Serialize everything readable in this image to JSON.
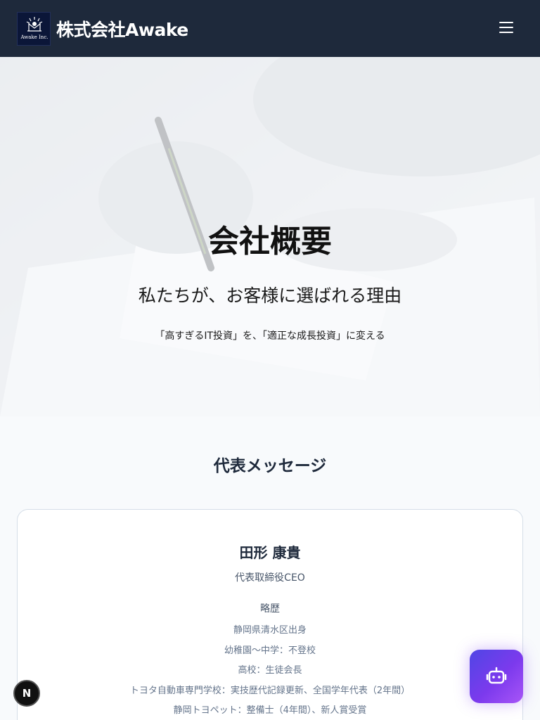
{
  "header": {
    "logo_text": "Awake Inc.",
    "brand": "株式会社Awake",
    "menu_icon": "hamburger-menu-icon"
  },
  "hero": {
    "title": "会社概要",
    "subtitle": "私たちが、お客様に選ばれる理由",
    "tagline": "「高すぎるIT投資」を、「適正な成長投資」に変える"
  },
  "message": {
    "section_title": "代表メッセージ",
    "name": "田形 康貴",
    "role": "代表取締役CEO",
    "bio_heading": "略歴",
    "bio": [
      "静岡県清水区出身",
      "幼稚園〜中学：不登校",
      "高校：生徒会長",
      "トヨタ自動車専門学校：実技歴代記録更新、全国学年代表（2年間）",
      "静岡トヨペット：整備士（4年間）、新人賞受賞"
    ]
  },
  "floating": {
    "next_badge": "N",
    "chat_icon": "robot-icon"
  },
  "colors": {
    "header_bg": "#1e293b",
    "accent_gradient_start": "#4f46e5",
    "accent_gradient_end": "#a855f7"
  }
}
